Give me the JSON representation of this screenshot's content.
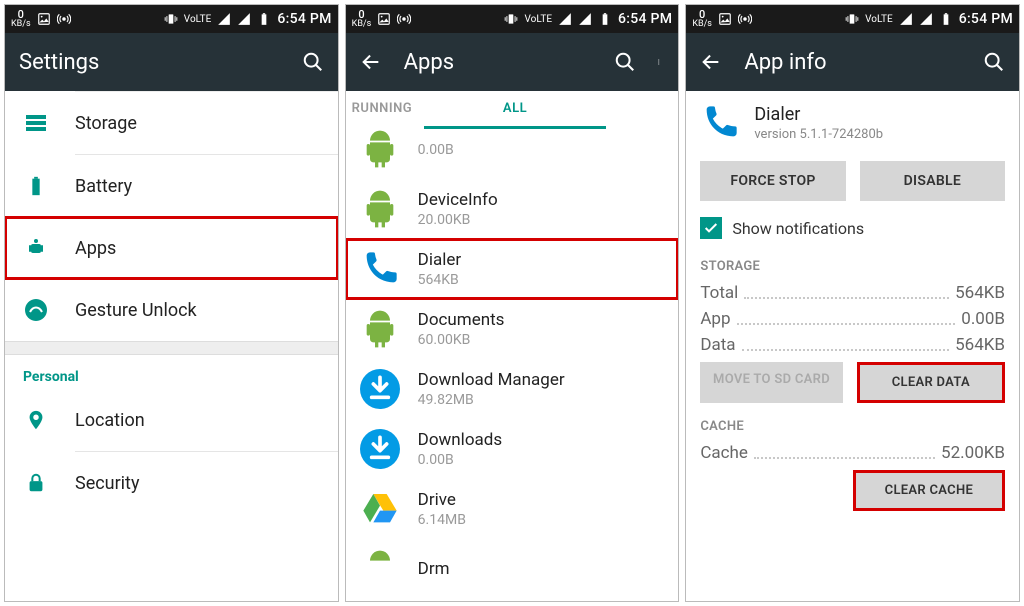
{
  "status": {
    "kbps": "0",
    "kbps_unit": "KB/s",
    "volte": "VoLTE",
    "time": "6:54 PM"
  },
  "screen1": {
    "title": "Settings",
    "items": {
      "storage": "Storage",
      "battery": "Battery",
      "apps": "Apps",
      "gesture": "Gesture Unlock"
    },
    "personal_label": "Personal",
    "personal": {
      "location": "Location",
      "security": "Security"
    }
  },
  "screen2": {
    "title": "Apps",
    "tab_running": "RUNNING",
    "tab_all": "ALL",
    "apps": [
      {
        "name": "",
        "size": "0.00B",
        "icon": "android"
      },
      {
        "name": "DeviceInfo",
        "size": "20.00KB",
        "icon": "android"
      },
      {
        "name": "Dialer",
        "size": "564KB",
        "icon": "phone"
      },
      {
        "name": "Documents",
        "size": "60.00KB",
        "icon": "android"
      },
      {
        "name": "Download Manager",
        "size": "49.82MB",
        "icon": "download"
      },
      {
        "name": "Downloads",
        "size": "0.00B",
        "icon": "download"
      },
      {
        "name": "Drive",
        "size": "6.14MB",
        "icon": "drive"
      },
      {
        "name": "Drm",
        "size": "",
        "icon": "android"
      }
    ]
  },
  "screen3": {
    "title": "App info",
    "app_name": "Dialer",
    "app_version": "version 5.1.1-724280b",
    "force_stop": "FORCE STOP",
    "disable": "DISABLE",
    "show_notifications": "Show notifications",
    "storage_label": "STORAGE",
    "total_label": "Total",
    "total_val": "564KB",
    "app_label": "App",
    "app_val": "0.00B",
    "data_label": "Data",
    "data_val": "564KB",
    "move_sd": "MOVE TO SD CARD",
    "clear_data": "CLEAR DATA",
    "cache_label": "CACHE",
    "cache_row_label": "Cache",
    "cache_val": "52.00KB",
    "clear_cache": "CLEAR CACHE"
  }
}
